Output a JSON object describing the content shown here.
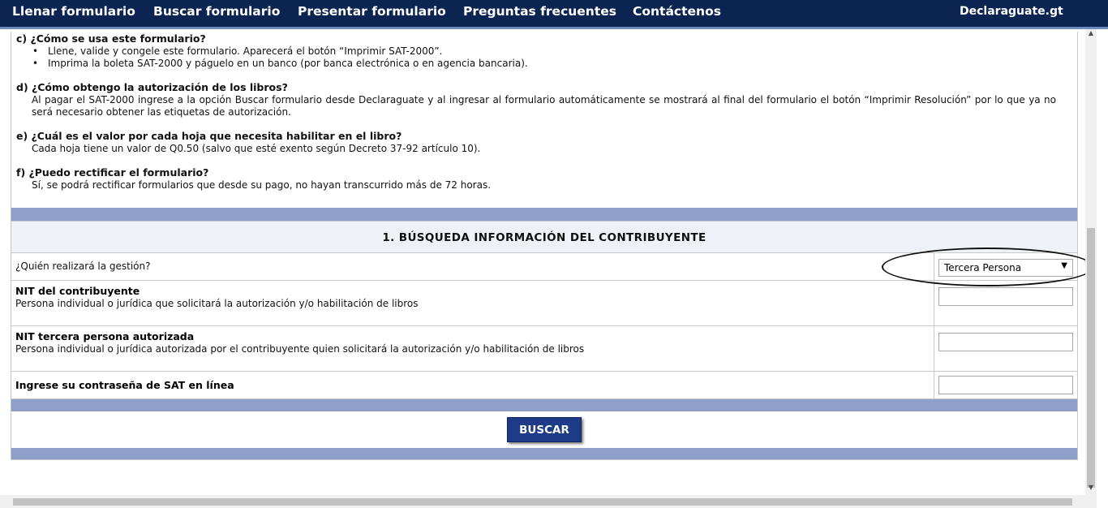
{
  "nav": {
    "items": [
      "Llenar formulario",
      "Buscar formulario",
      "Presentar formulario",
      "Preguntas frecuentes",
      "Contáctenos"
    ],
    "brand": "Declaraguate.gt"
  },
  "faq": {
    "c": {
      "question": "c) ¿Cómo se usa este formulario?",
      "bullets": [
        "Llene, valide y congele este formulario. Aparecerá el botón “Imprimir SAT-2000”.",
        "Imprima la boleta SAT-2000 y páguelo en un banco (por banca electrónica o en agencia bancaria)."
      ]
    },
    "d": {
      "question": "d) ¿Cómo obtengo la autorización de los libros?",
      "answer": "Al pagar el SAT-2000 ingrese a la opción Buscar formulario desde Declaraguate y al ingresar al formulario automáticamente se mostrará al final del formulario el botón “Imprimir Resolución” por lo que ya no será necesario obtener las etiquetas de autorización."
    },
    "e": {
      "question": "e) ¿Cuál es el valor por cada hoja que necesita habilitar en el libro?",
      "answer": "Cada hoja tiene un valor de Q0.50 (salvo que esté exento según Decreto 37-92 artículo 10)."
    },
    "f": {
      "question": "f) ¿Puedo rectificar el formulario?",
      "answer": "Sí, se podrá rectificar formularios que desde su pago, no hayan transcurrido más de 72 horas."
    }
  },
  "section": {
    "title": "1. BÚSQUEDA INFORMACIÓN DEL CONTRIBUYENTE"
  },
  "form": {
    "gestion_label": "¿Quién realizará la gestión?",
    "gestion_value": "Tercera Persona",
    "nit_title": "NIT del contribuyente",
    "nit_desc": "Persona individual o jurídica que solicitará la autorización y/o habilitación de libros",
    "nit_tercero_title": "NIT tercera persona autorizada",
    "nit_tercero_desc": "Persona individual o jurídica autorizada por el contribuyente quien solicitará la autorización y/o habilitación de libros",
    "password_title": "Ingrese su contraseña de SAT en línea",
    "nit_value": "",
    "nit_tercero_value": "",
    "password_value": ""
  },
  "buttons": {
    "search": "BUSCAR"
  },
  "colors": {
    "navbar": "#0c2451",
    "strip": "#8ea0c9",
    "button": "#1d3b87",
    "section_bg": "#eef1f5"
  },
  "icons": {
    "select_arrow": "triangle-down-icon",
    "scroll_up": "triangle-up-icon",
    "scroll_down": "triangle-down-icon"
  }
}
